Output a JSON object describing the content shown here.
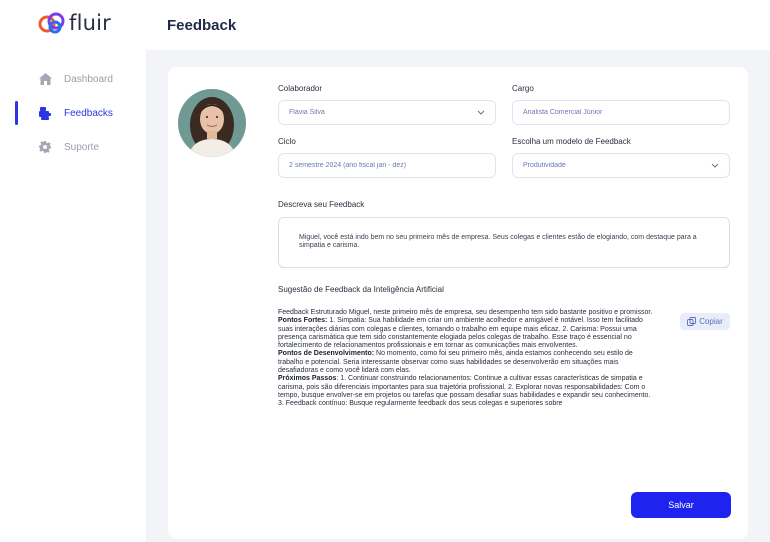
{
  "app": {
    "logo_text": "fluir"
  },
  "sidebar": {
    "items": [
      {
        "label": "Dashboard",
        "icon": "home-icon",
        "active": false
      },
      {
        "label": "Feedbacks",
        "icon": "feedback-icon",
        "active": true
      },
      {
        "label": "Suporte",
        "icon": "gear-icon",
        "active": false
      }
    ]
  },
  "header": {
    "title": "Feedback"
  },
  "form": {
    "colaborador": {
      "label": "Colaborador",
      "value": "Flávia Silva"
    },
    "cargo": {
      "label": "Cargo",
      "value": "Analista Comercial  Júnior"
    },
    "ciclo": {
      "label": "Ciclo",
      "value": "2 semestre 2024 (ano fiscal jan - dez)"
    },
    "modelo": {
      "label": "Escolha um modelo de Feedback",
      "value": "Produtividade"
    },
    "descricao": {
      "label": "Descreva seu Feedback",
      "value": "Miguel, você está indo bem no seu primeiro mês de empresa. Seus colegas e clientes estão de elogiando, com destaque para a simpatia e carisma."
    }
  },
  "ai": {
    "title": "Sugestão de Feedback da Inteligência Artificial",
    "intro": "Feedback Estruturado Miguel, neste primeiro mês de empresa, seu desempenho tem sido bastante positivo e promissor.",
    "strengths_title": "Pontos Fortes:",
    "strengths_text": " 1. Simpatia: Sua habilidade em criar um ambiente acolhedor e amigável é notável. Isso tem facilitado suas interações diárias com colegas e clientes, tornando o trabalho em equipe mais eficaz. 2. Carisma: Possui uma presença carismática que tem sido constantemente elogiada pelos colegas de trabalho. Esse traço é essencial no fortalecimento de relacionamentos profissionais e em tornar as comunicações mais envolventes.",
    "development_title": "Pontos de Desenvolvimento:",
    "development_text": " No momento, como foi seu primeiro mês, ainda estamos conhecendo seu estilo de trabalho e potencial. Seria interessante observar como suas habilidades se desenvolverão em situações mais desafiadoras e como você lidará com elas.",
    "next_title": "Próximos Passos",
    "next_text": ": 1. Continuar construindo relacionamentos: Continue a cultivar essas características de simpatia e carisma, pois são diferenciais importantes para sua trajetória profissional. 2. Explorar novas responsabilidades: Com o tempo, busque envolver-se em projetos ou tarefas que possam desafiar suas habilidades e expandir seu conhecimento. 3. Feedback contínuo: Busque regularmente feedback dos seus colegas e superiores sobre",
    "copy_label": "Copiar"
  },
  "actions": {
    "save_label": "Salvar"
  },
  "colors": {
    "primary": "#1f23f0",
    "accent_text": "#6b78b8",
    "active_nav": "#2b35e6"
  }
}
